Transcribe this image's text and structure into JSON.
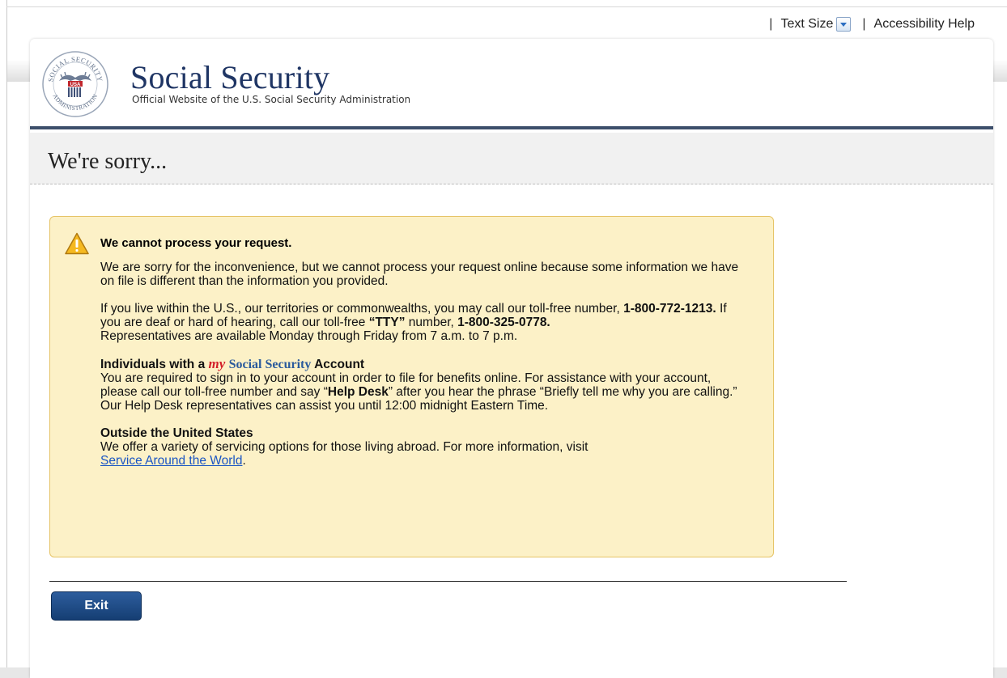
{
  "utility": {
    "separator": "|",
    "text_size_label": "Text Size",
    "accessibility_label": "Accessibility Help"
  },
  "header": {
    "seal_icon": "ssa-seal-icon",
    "seal_top_text": "SOCIAL SECURITY",
    "seal_bottom_text": "ADMINISTRATION",
    "seal_center_text": "USA",
    "title": "Social Security",
    "subtitle": "Official Website of the U.S. Social Security Administration"
  },
  "page": {
    "title": "We're sorry..."
  },
  "alert": {
    "icon": "warning-icon",
    "heading": "We cannot process your request.",
    "p1": "We are sorry for the inconvenience, but we cannot process your request online because some information we have on file is different than the information you provided.",
    "p2_a": "If you live within the U.S., our territories or commonwealths, you may call our toll-free number, ",
    "p2_phone": "1-800-772-1213.",
    "p2_b": "  If you are deaf or hard of hearing, call our toll-free ",
    "p2_tty": "“TTY”",
    "p2_c": " number, ",
    "p2_tty_phone": "1-800-325-0778.",
    "p2_d": " Representatives are available Monday through Friday from 7 a.m. to 7 p.m.",
    "my_heading_pre": "Individuals with a ",
    "my_word": "my",
    "ss_word": "Social Security",
    "my_heading_post": " Account",
    "p3_a": "You are required to sign in to your account in order to file for benefits online.  For assistance with your account, please call our toll-free number and say “",
    "p3_help": "Help Desk",
    "p3_b": "” after you hear the phrase “Briefly tell me why you are calling.”  Our Help Desk representatives can assist you until 12:00 midnight Eastern Time.",
    "outside_heading": "Outside the United States",
    "p4": "We offer a variety of servicing options for those living abroad. For more information, visit",
    "p4_link": "Service Around the World",
    "p4_end": "."
  },
  "actions": {
    "exit_label": "Exit"
  },
  "colors": {
    "brand_navy": "#1f3564",
    "alert_bg": "#fcf1c7",
    "alert_border": "#e6c467",
    "link": "#1a55c4",
    "my_red": "#d3202a"
  }
}
